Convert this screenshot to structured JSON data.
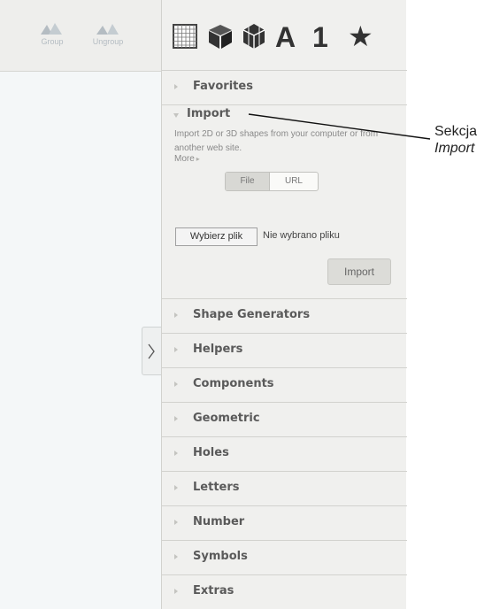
{
  "toolbar": {
    "group_label": "Group",
    "ungroup_label": "Ungroup"
  },
  "panel_header": {
    "icons": [
      "grid-icon",
      "box-icon",
      "gem-icon",
      "letter-icon",
      "number-icon",
      "star-icon"
    ],
    "letter_glyph": "A",
    "number_glyph": "1",
    "star_glyph": "★"
  },
  "sections": {
    "favorites": "Favorites",
    "import": {
      "title": "Import",
      "description": "Import 2D or 3D shapes from your computer or from another web site.",
      "more": "More",
      "tabs": [
        "File",
        "URL"
      ],
      "selected_tab": "File",
      "choose_file": "Wybierz plik",
      "no_file": "Nie wybrano pliku",
      "import_button": "Import"
    },
    "list": [
      "Shape Generators",
      "Helpers",
      "Components",
      "Geometric",
      "Holes",
      "Letters",
      "Number",
      "Symbols",
      "Extras"
    ]
  },
  "callout": {
    "line1": "Sekcja",
    "line2": "Import"
  },
  "colors": {
    "panel_bg": "#f0f0ee",
    "workplane_bg": "#f4f7f8",
    "toolbar_icon": "#b4bcc2"
  }
}
